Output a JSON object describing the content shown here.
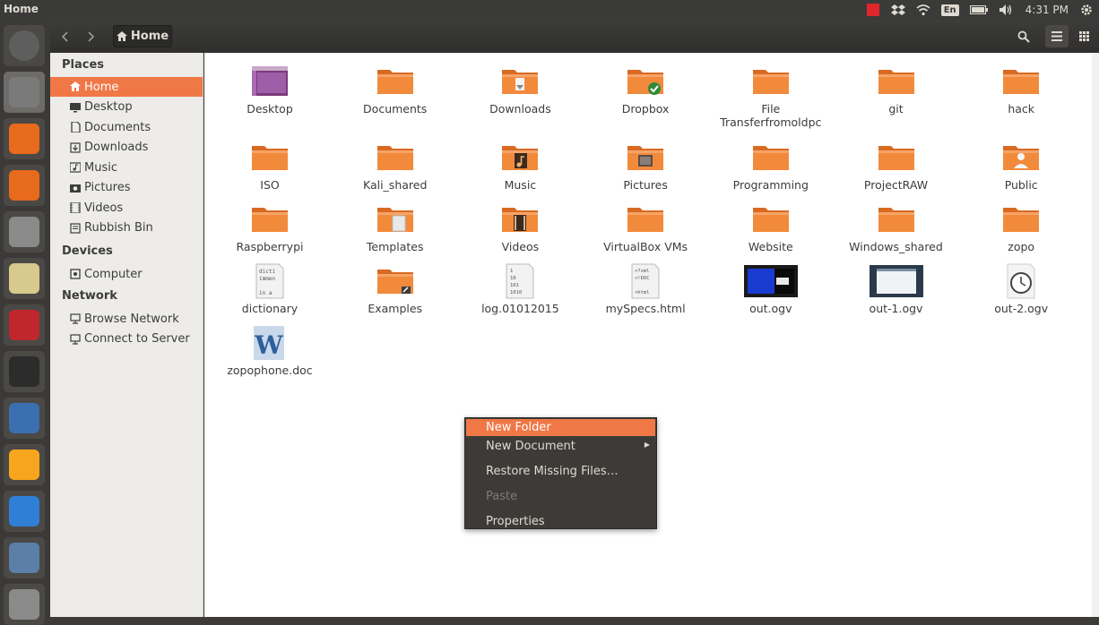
{
  "window": {
    "title": "Home"
  },
  "topbar": {
    "lang": "En",
    "time": "4:31 PM"
  },
  "launcher": {
    "items": [
      {
        "name": "ubuntu-dash-icon",
        "color": "#5e5e5e"
      },
      {
        "name": "files-icon",
        "color": "#7a7a7a"
      },
      {
        "name": "firefox-icon",
        "color": "#e86a1c"
      },
      {
        "name": "software-center-icon",
        "color": "#e86a1c"
      },
      {
        "name": "system-settings-icon",
        "color": "#8a8a8a"
      },
      {
        "name": "rhythmbox-icon",
        "color": "#d8c98c"
      },
      {
        "name": "webcam-icon",
        "color": "#c0272d"
      },
      {
        "name": "terminal-icon",
        "color": "#2c2c2c"
      },
      {
        "name": "virtualbox-icon",
        "color": "#3a6fb0"
      },
      {
        "name": "audacity-icon",
        "color": "#f7a51c"
      },
      {
        "name": "dropbox-icon",
        "color": "#2f7fd6"
      },
      {
        "name": "app-icon",
        "color": "#5b7fa6"
      },
      {
        "name": "trash-icon",
        "color": "#8a8a8a"
      }
    ]
  },
  "toolbar": {
    "breadcrumb_label": "Home"
  },
  "sidebar": {
    "places_heading": "Places",
    "places": [
      {
        "label": "Home",
        "icon": "home-icon"
      },
      {
        "label": "Desktop",
        "icon": "desktop-icon"
      },
      {
        "label": "Documents",
        "icon": "documents-icon"
      },
      {
        "label": "Downloads",
        "icon": "downloads-icon"
      },
      {
        "label": "Music",
        "icon": "music-icon"
      },
      {
        "label": "Pictures",
        "icon": "pictures-icon"
      },
      {
        "label": "Videos",
        "icon": "videos-icon"
      },
      {
        "label": "Rubbish Bin",
        "icon": "trash-icon"
      }
    ],
    "devices_heading": "Devices",
    "devices": [
      {
        "label": "Computer",
        "icon": "computer-icon"
      }
    ],
    "network_heading": "Network",
    "network": [
      {
        "label": "Browse Network",
        "icon": "network-icon"
      },
      {
        "label": "Connect to Server",
        "icon": "server-icon"
      }
    ]
  },
  "files": [
    {
      "name": "Desktop",
      "kind": "desktop"
    },
    {
      "name": "Documents",
      "kind": "folder"
    },
    {
      "name": "Downloads",
      "kind": "folder-download"
    },
    {
      "name": "Dropbox",
      "kind": "folder-dropbox"
    },
    {
      "name": "File\nTransferfromoldpc",
      "kind": "folder"
    },
    {
      "name": "git",
      "kind": "folder"
    },
    {
      "name": "hack",
      "kind": "folder"
    },
    {
      "name": "ISO",
      "kind": "folder"
    },
    {
      "name": "Kali_shared",
      "kind": "folder"
    },
    {
      "name": "Music",
      "kind": "folder-music"
    },
    {
      "name": "Pictures",
      "kind": "folder-pictures"
    },
    {
      "name": "Programming",
      "kind": "folder"
    },
    {
      "name": "ProjectRAW",
      "kind": "folder"
    },
    {
      "name": "Public",
      "kind": "folder-public"
    },
    {
      "name": "Raspberrypi",
      "kind": "folder"
    },
    {
      "name": "Templates",
      "kind": "folder-templates"
    },
    {
      "name": "Videos",
      "kind": "folder-videos"
    },
    {
      "name": "VirtualBox VMs",
      "kind": "folder"
    },
    {
      "name": "Website",
      "kind": "folder"
    },
    {
      "name": "Windows_shared",
      "kind": "folder"
    },
    {
      "name": "zopo",
      "kind": "folder"
    },
    {
      "name": "dictionary",
      "kind": "text-dict"
    },
    {
      "name": "Examples",
      "kind": "folder-link"
    },
    {
      "name": "log.01012015",
      "kind": "text-log"
    },
    {
      "name": "mySpecs.html",
      "kind": "text-html"
    },
    {
      "name": "out.ogv",
      "kind": "video-1"
    },
    {
      "name": "out-1.ogv",
      "kind": "video-2"
    },
    {
      "name": "out-2.ogv",
      "kind": "clock"
    },
    {
      "name": "zopophone.doc",
      "kind": "word"
    }
  ],
  "context_menu": {
    "items": [
      {
        "label": "New Folder",
        "state": "highlighted",
        "submenu": false
      },
      {
        "label": "New Document",
        "state": "normal",
        "submenu": true
      },
      {
        "label": "Restore Missing Files…",
        "state": "normal",
        "submenu": false
      },
      {
        "label": "Paste",
        "state": "disabled",
        "submenu": false
      },
      {
        "label": "Properties",
        "state": "normal",
        "submenu": false
      }
    ]
  },
  "colors": {
    "accent": "#f07746",
    "folder": "#f28a3c"
  }
}
